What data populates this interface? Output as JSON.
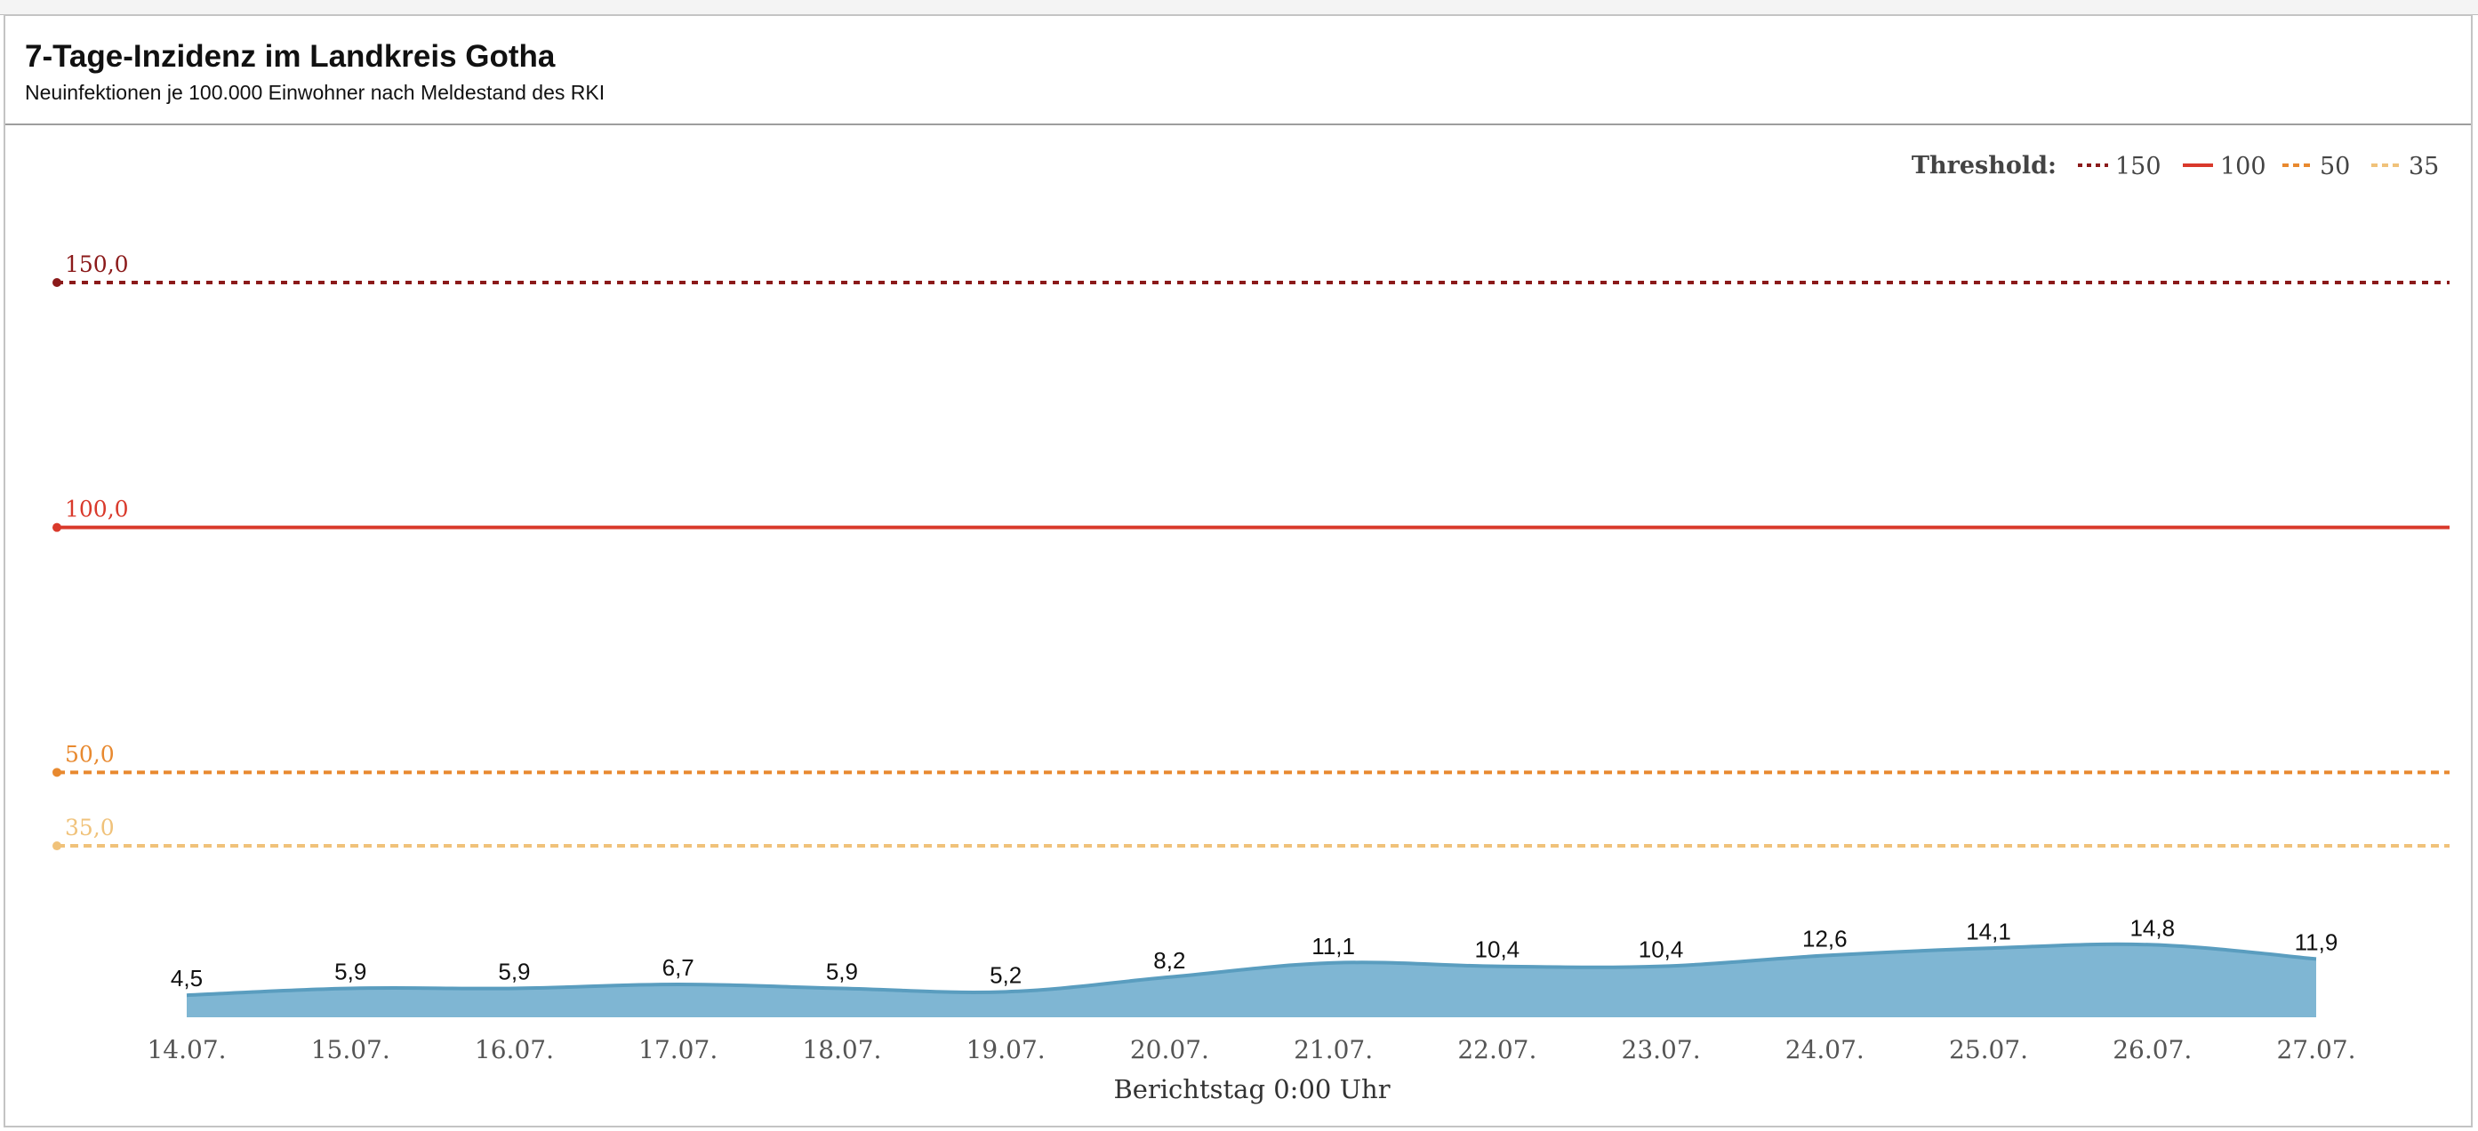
{
  "header": {
    "title": "7-Tage-Inzidenz im Landkreis Gotha",
    "subtitle": "Neuinfektionen je 100.000 Einwohner nach Meldestand des RKI"
  },
  "legend": {
    "title": "Threshold:",
    "items": [
      {
        "label": "150",
        "color": "#8b1a1a",
        "style": "dotted"
      },
      {
        "label": "100",
        "color": "#d9392b",
        "style": "solid"
      },
      {
        "label": "50",
        "color": "#e8892f",
        "style": "dashed"
      },
      {
        "label": "35",
        "color": "#f0c27a",
        "style": "dashed"
      }
    ]
  },
  "chart_data": {
    "type": "area",
    "title": "7-Tage-Inzidenz im Landkreis Gotha",
    "subtitle": "Neuinfektionen je 100.000 Einwohner nach Meldestand des RKI",
    "xlabel": "Berichtstag 0:00 Uhr",
    "ylabel": "",
    "categories": [
      "14.07.",
      "15.07.",
      "16.07.",
      "17.07.",
      "18.07.",
      "19.07.",
      "20.07.",
      "21.07.",
      "22.07.",
      "23.07.",
      "24.07.",
      "25.07.",
      "26.07.",
      "27.07."
    ],
    "values": [
      4.5,
      5.9,
      5.9,
      6.7,
      5.9,
      5.2,
      8.2,
      11.1,
      10.4,
      10.4,
      12.6,
      14.1,
      14.8,
      11.9
    ],
    "value_labels": [
      "4,5",
      "5,9",
      "5,9",
      "6,7",
      "5,9",
      "5,2",
      "8,2",
      "11,1",
      "10,4",
      "10,4",
      "12,6",
      "14,1",
      "14,8",
      "11,9"
    ],
    "ylim": [
      0,
      150
    ],
    "grid": false,
    "area_color": "#7fb6d3",
    "line_color": "#5a9dbf",
    "thresholds": [
      {
        "value": 150,
        "label": "150,0",
        "color": "#8b1a1a",
        "style": "dotted"
      },
      {
        "value": 100,
        "label": "100,0",
        "color": "#d9392b",
        "style": "solid"
      },
      {
        "value": 50,
        "label": "50,0",
        "color": "#e8892f",
        "style": "dashed"
      },
      {
        "value": 35,
        "label": "35,0",
        "color": "#f0c27a",
        "style": "dashed"
      }
    ],
    "legend_position": "top-right"
  }
}
